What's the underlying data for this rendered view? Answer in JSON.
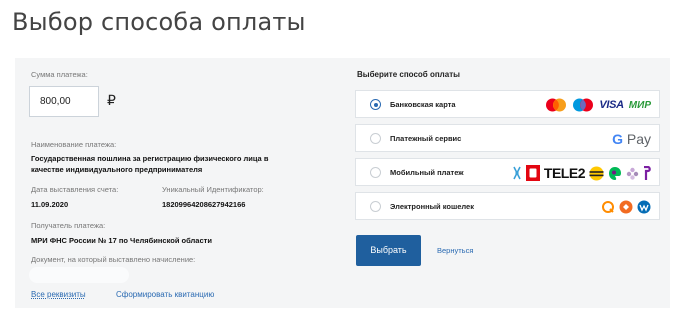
{
  "page": {
    "title": "Выбор способа оплаты"
  },
  "payment": {
    "amount_label": "Сумма платежа:",
    "amount_value": "800,00",
    "currency": "₽",
    "name_label": "Наименование платежа:",
    "name_line1": "Государственная пошлина за регистрацию физического лица в",
    "name_line2": "качестве индивидуального предпринимателя",
    "date_label": "Дата выставления счета:",
    "date_value": "11.09.2020",
    "uid_label": "Уникальный Идентификатор:",
    "uid_value": "18209964208627942166",
    "recipient_label": "Получатель платежа:",
    "recipient_value": "МРИ ФНС России № 17 по Челябинской области",
    "document_label": "Документ, на который выставлено начисление:",
    "link_details": "Все реквизиты",
    "link_receipt": "Сформировать квитанцию"
  },
  "methods": {
    "title": "Выберите способ оплаты",
    "options": [
      {
        "label": "Банковская карта",
        "selected": true,
        "logos": [
          "mastercard-logo",
          "maestro-logo",
          "visa-logo",
          "mir-logo"
        ]
      },
      {
        "label": "Платежный сервис",
        "selected": false,
        "logos": [
          "google-pay-logo"
        ]
      },
      {
        "label": "Мобильный платеж",
        "selected": false,
        "logos": [
          "operator-logo",
          "mts-logo",
          "tele2-logo",
          "beeline-logo",
          "megafon-logo",
          "motiv-logo",
          "yota-logo"
        ]
      },
      {
        "label": "Электронный кошелек",
        "selected": false,
        "logos": [
          "qiwi-logo",
          "yoomoney-logo",
          "webmoney-logo"
        ]
      }
    ],
    "visa_text": "VISA",
    "mir_text": "МИР",
    "gpay_g": "G",
    "gpay_text": "Pay",
    "tele2_text": "TELE2",
    "submit": "Выбрать",
    "back": "Вернуться"
  },
  "colors": {
    "accent": "#1f5f9e",
    "link": "#2a6ab2",
    "panel": "#f4f5f6"
  }
}
